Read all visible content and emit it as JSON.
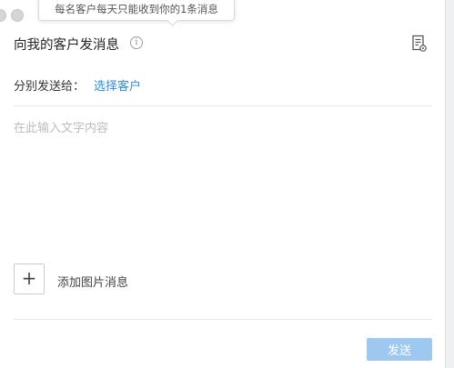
{
  "tooltip": {
    "text": "每名客户每天只能收到你的1条消息"
  },
  "header": {
    "title": "向我的客户发消息",
    "info_icon": "info-icon",
    "doc_icon": "document-settings-icon"
  },
  "recipients": {
    "label": "分别发送给：",
    "select_link": "选择客户"
  },
  "message": {
    "placeholder": "在此输入文字内容",
    "value": ""
  },
  "image": {
    "add_symbol": "+",
    "label": "添加图片消息"
  },
  "footer": {
    "send_label": "发送"
  },
  "colors": {
    "link": "#2f8dd8",
    "send_button": "#9ec8ef"
  }
}
